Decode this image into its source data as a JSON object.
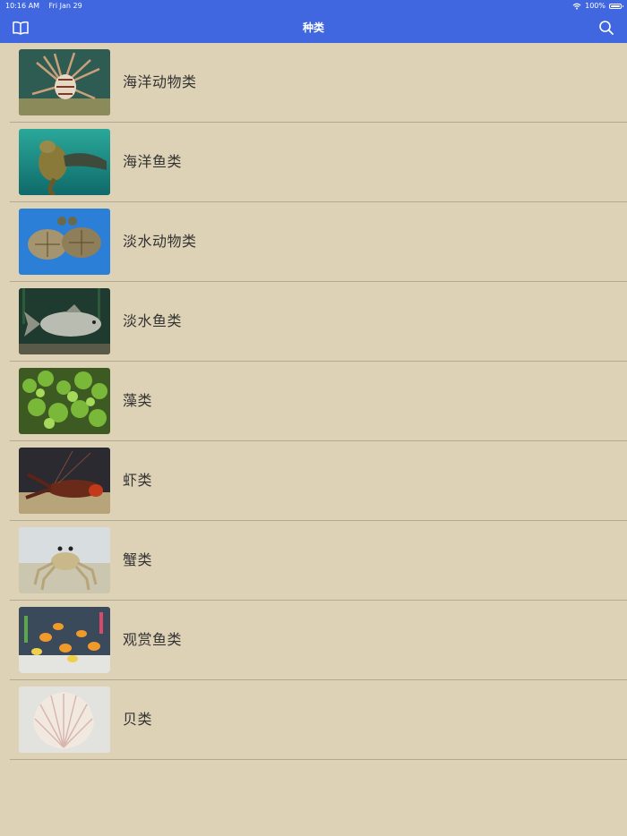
{
  "status_bar": {
    "time": "10:16 AM",
    "date": "Fri Jan 29",
    "battery": "100%"
  },
  "nav": {
    "title": "种类",
    "left_icon": "book-icon",
    "right_icon": "search-icon"
  },
  "categories": [
    {
      "label": "海洋动物类",
      "image": "lionfish"
    },
    {
      "label": "海洋鱼类",
      "image": "sea-lion"
    },
    {
      "label": "淡水动物类",
      "image": "turtles"
    },
    {
      "label": "淡水鱼类",
      "image": "carp"
    },
    {
      "label": "藻类",
      "image": "aquatic-plants"
    },
    {
      "label": "虾类",
      "image": "lobster"
    },
    {
      "label": "蟹类",
      "image": "crab"
    },
    {
      "label": "观赏鱼类",
      "image": "ornamental-fish"
    },
    {
      "label": "贝类",
      "image": "scallop-shell"
    }
  ],
  "colors": {
    "nav_background": "#4066e0",
    "page_background": "#ded2b6",
    "separator": "#b1a991",
    "label_text": "#333333"
  }
}
